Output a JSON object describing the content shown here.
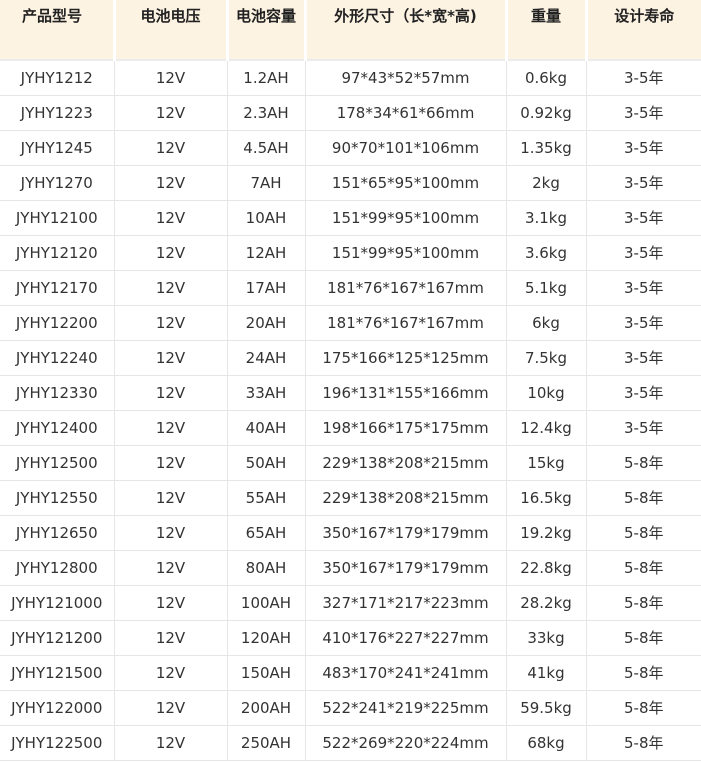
{
  "headers": [
    "产品型号",
    "电池电压",
    "电池容量",
    "外形尺寸（长*宽*高)",
    "重量",
    "设计寿命"
  ],
  "rows": [
    [
      "JYHY1212",
      "12V",
      "1.2AH",
      "97*43*52*57mm",
      "0.6kg",
      "3-5年"
    ],
    [
      "JYHY1223",
      "12V",
      "2.3AH",
      "178*34*61*66mm",
      "0.92kg",
      "3-5年"
    ],
    [
      "JYHY1245",
      "12V",
      "4.5AH",
      "90*70*101*106mm",
      "1.35kg",
      "3-5年"
    ],
    [
      "JYHY1270",
      "12V",
      "7AH",
      "151*65*95*100mm",
      "2kg",
      "3-5年"
    ],
    [
      "JYHY12100",
      "12V",
      "10AH",
      "151*99*95*100mm",
      "3.1kg",
      "3-5年"
    ],
    [
      "JYHY12120",
      "12V",
      "12AH",
      "151*99*95*100mm",
      "3.6kg",
      "3-5年"
    ],
    [
      "JYHY12170",
      "12V",
      "17AH",
      "181*76*167*167mm",
      "5.1kg",
      "3-5年"
    ],
    [
      "JYHY12200",
      "12V",
      "20AH",
      "181*76*167*167mm",
      "6kg",
      "3-5年"
    ],
    [
      "JYHY12240",
      "12V",
      "24AH",
      "175*166*125*125mm",
      "7.5kg",
      "3-5年"
    ],
    [
      "JYHY12330",
      "12V",
      "33AH",
      "196*131*155*166mm",
      "10kg",
      "3-5年"
    ],
    [
      "JYHY12400",
      "12V",
      "40AH",
      "198*166*175*175mm",
      "12.4kg",
      "3-5年"
    ],
    [
      "JYHY12500",
      "12V",
      "50AH",
      "229*138*208*215mm",
      "15kg",
      "5-8年"
    ],
    [
      "JYHY12550",
      "12V",
      "55AH",
      "229*138*208*215mm",
      "16.5kg",
      "5-8年"
    ],
    [
      "JYHY12650",
      "12V",
      "65AH",
      "350*167*179*179mm",
      "19.2kg",
      "5-8年"
    ],
    [
      "JYHY12800",
      "12V",
      "80AH",
      "350*167*179*179mm",
      "22.8kg",
      "5-8年"
    ],
    [
      "JYHY121000",
      "12V",
      "100AH",
      "327*171*217*223mm",
      "28.2kg",
      "5-8年"
    ],
    [
      "JYHY121200",
      "12V",
      "120AH",
      "410*176*227*227mm",
      "33kg",
      "5-8年"
    ],
    [
      "JYHY121500",
      "12V",
      "150AH",
      "483*170*241*241mm",
      "41kg",
      "5-8年"
    ],
    [
      "JYHY122000",
      "12V",
      "200AH",
      "522*241*219*225mm",
      "59.5kg",
      "5-8年"
    ],
    [
      "JYHY122500",
      "12V",
      "250AH",
      "522*269*220*224mm",
      "68kg",
      "5-8年"
    ]
  ]
}
